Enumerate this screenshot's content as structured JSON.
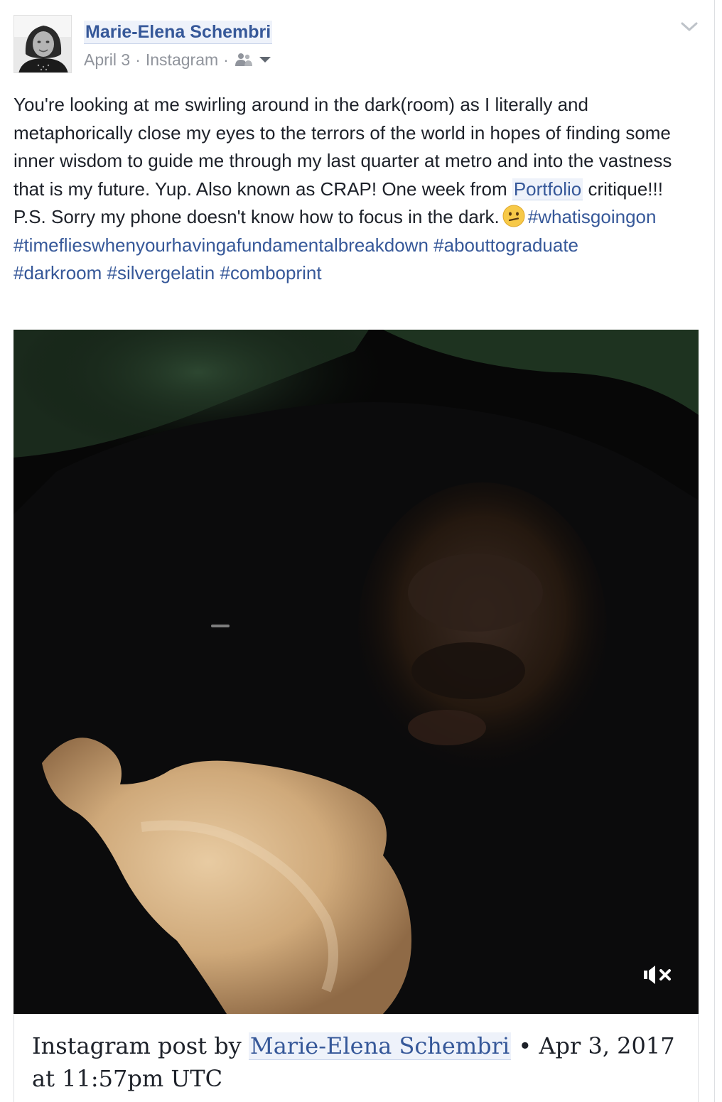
{
  "post": {
    "author_name": "Marie-Elena Schembri",
    "date": "April 3",
    "separator": "·",
    "source": "Instagram",
    "audience_icon": "friends-icon",
    "menu_icon": "chevron-down-icon",
    "text_part1": "You're looking at me swirling around in the dark(room) as I literally and metaphorically close my eyes to the terrors of the world in hopes of finding some inner wisdom to guide me through my last quarter at metro and into the vastness that is my future. Yup. Also known as CRAP! One week from ",
    "mention": "Portfolio",
    "text_part2": " critique!!! P.S. Sorry my phone doesn't know how to focus in the dark.",
    "emoji": "confused-face-emoji",
    "hashtags": [
      "#whatisgoingon",
      "#timeflieswhenyourhavingafundamentalbreakdown",
      "#abouttograduate",
      "#darkroom",
      "#silvergelatin",
      "#comboprint"
    ]
  },
  "media": {
    "type": "video",
    "mute_icon": "volume-muted-icon"
  },
  "caption": {
    "prefix": "Instagram post by ",
    "author": "Marie-Elena Schembri",
    "suffix": " • Apr 3, 2017 at 11:57pm UTC"
  },
  "colors": {
    "link": "#365899",
    "text": "#1d2129",
    "meta": "#90949c",
    "mention_bg": "#eef2fa"
  }
}
